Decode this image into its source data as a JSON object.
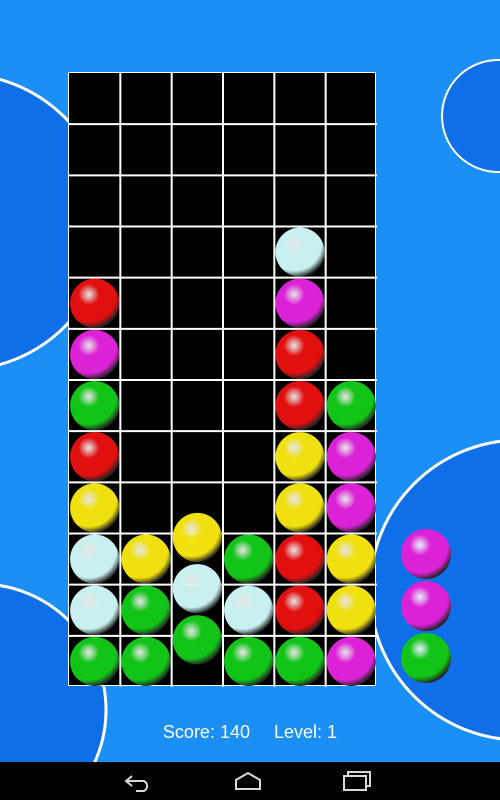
{
  "colors": {
    "background": "#1a8ff5",
    "deco_fill": "#0f6fe8",
    "deco_stroke": "#ffffff",
    "board_bg": "#000000",
    "grid_line": "#ffffff",
    "red": "#e01010",
    "magenta": "#dc22d6",
    "green": "#12c418",
    "yellow": "#f0e010",
    "cyan": "#c8f0f0"
  },
  "grid": {
    "columns": 6,
    "rows": 12,
    "cells": [
      [
        "",
        "",
        "",
        "",
        "",
        ""
      ],
      [
        "",
        "",
        "",
        "",
        "",
        ""
      ],
      [
        "",
        "",
        "",
        "",
        "",
        ""
      ],
      [
        "",
        "",
        "",
        "",
        "cyan",
        ""
      ],
      [
        "red",
        "",
        "",
        "",
        "magenta",
        ""
      ],
      [
        "magenta",
        "",
        "",
        "",
        "red",
        ""
      ],
      [
        "green",
        "",
        "",
        "",
        "red",
        "green"
      ],
      [
        "red",
        "",
        "",
        "",
        "yellow",
        "magenta"
      ],
      [
        "yellow",
        "",
        "",
        "",
        "yellow",
        "magenta"
      ],
      [
        "cyan",
        "yellow",
        "",
        "green",
        "red",
        "yellow"
      ],
      [
        "cyan",
        "green",
        "",
        "cyan",
        "red",
        "yellow"
      ],
      [
        "green",
        "green",
        "",
        "green",
        "green",
        "magenta"
      ]
    ],
    "falling_column": {
      "column": 2,
      "balls": [
        "yellow",
        "cyan",
        "green"
      ]
    }
  },
  "next_piece": {
    "balls": [
      "magenta",
      "magenta",
      "green"
    ]
  },
  "status": {
    "score_label": "Score: 140",
    "level_label": "Level: 1"
  },
  "navbar": {
    "buttons": [
      {
        "icon": "back-icon"
      },
      {
        "icon": "home-icon"
      },
      {
        "icon": "recent-apps-icon"
      }
    ]
  }
}
